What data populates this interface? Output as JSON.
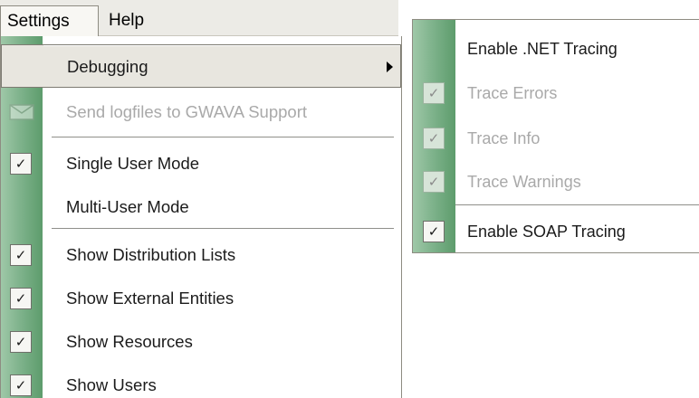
{
  "menubar": {
    "items": [
      {
        "label": "Settings"
      },
      {
        "label": "Help"
      }
    ]
  },
  "settings_menu": {
    "items": [
      {
        "label": "Debugging",
        "has_submenu": true,
        "highlighted": true
      },
      {
        "label": "Send logfiles to GWAVA Support",
        "disabled": true,
        "icon": "envelope-icon"
      },
      {
        "label": "Single User Mode",
        "checked": true
      },
      {
        "label": "Multi-User Mode",
        "checked": false
      },
      {
        "label": "Show Distribution Lists",
        "checked": true
      },
      {
        "label": "Show External Entities",
        "checked": true
      },
      {
        "label": "Show Resources",
        "checked": true
      },
      {
        "label": "Show Users",
        "checked": true
      }
    ]
  },
  "debugging_submenu": {
    "items": [
      {
        "label": "Enable .NET Tracing",
        "checked": false
      },
      {
        "label": "Trace Errors",
        "checked": true,
        "disabled": true
      },
      {
        "label": "Trace Info",
        "checked": true,
        "disabled": true
      },
      {
        "label": "Trace Warnings",
        "checked": true,
        "disabled": true
      },
      {
        "label": "Enable SOAP Tracing",
        "checked": true
      }
    ]
  },
  "glyphs": {
    "check": "✓"
  },
  "colors": {
    "gutter_green": "#7fb38c",
    "highlight": "#e8e6df",
    "disabled_text": "#a9a9a9"
  }
}
